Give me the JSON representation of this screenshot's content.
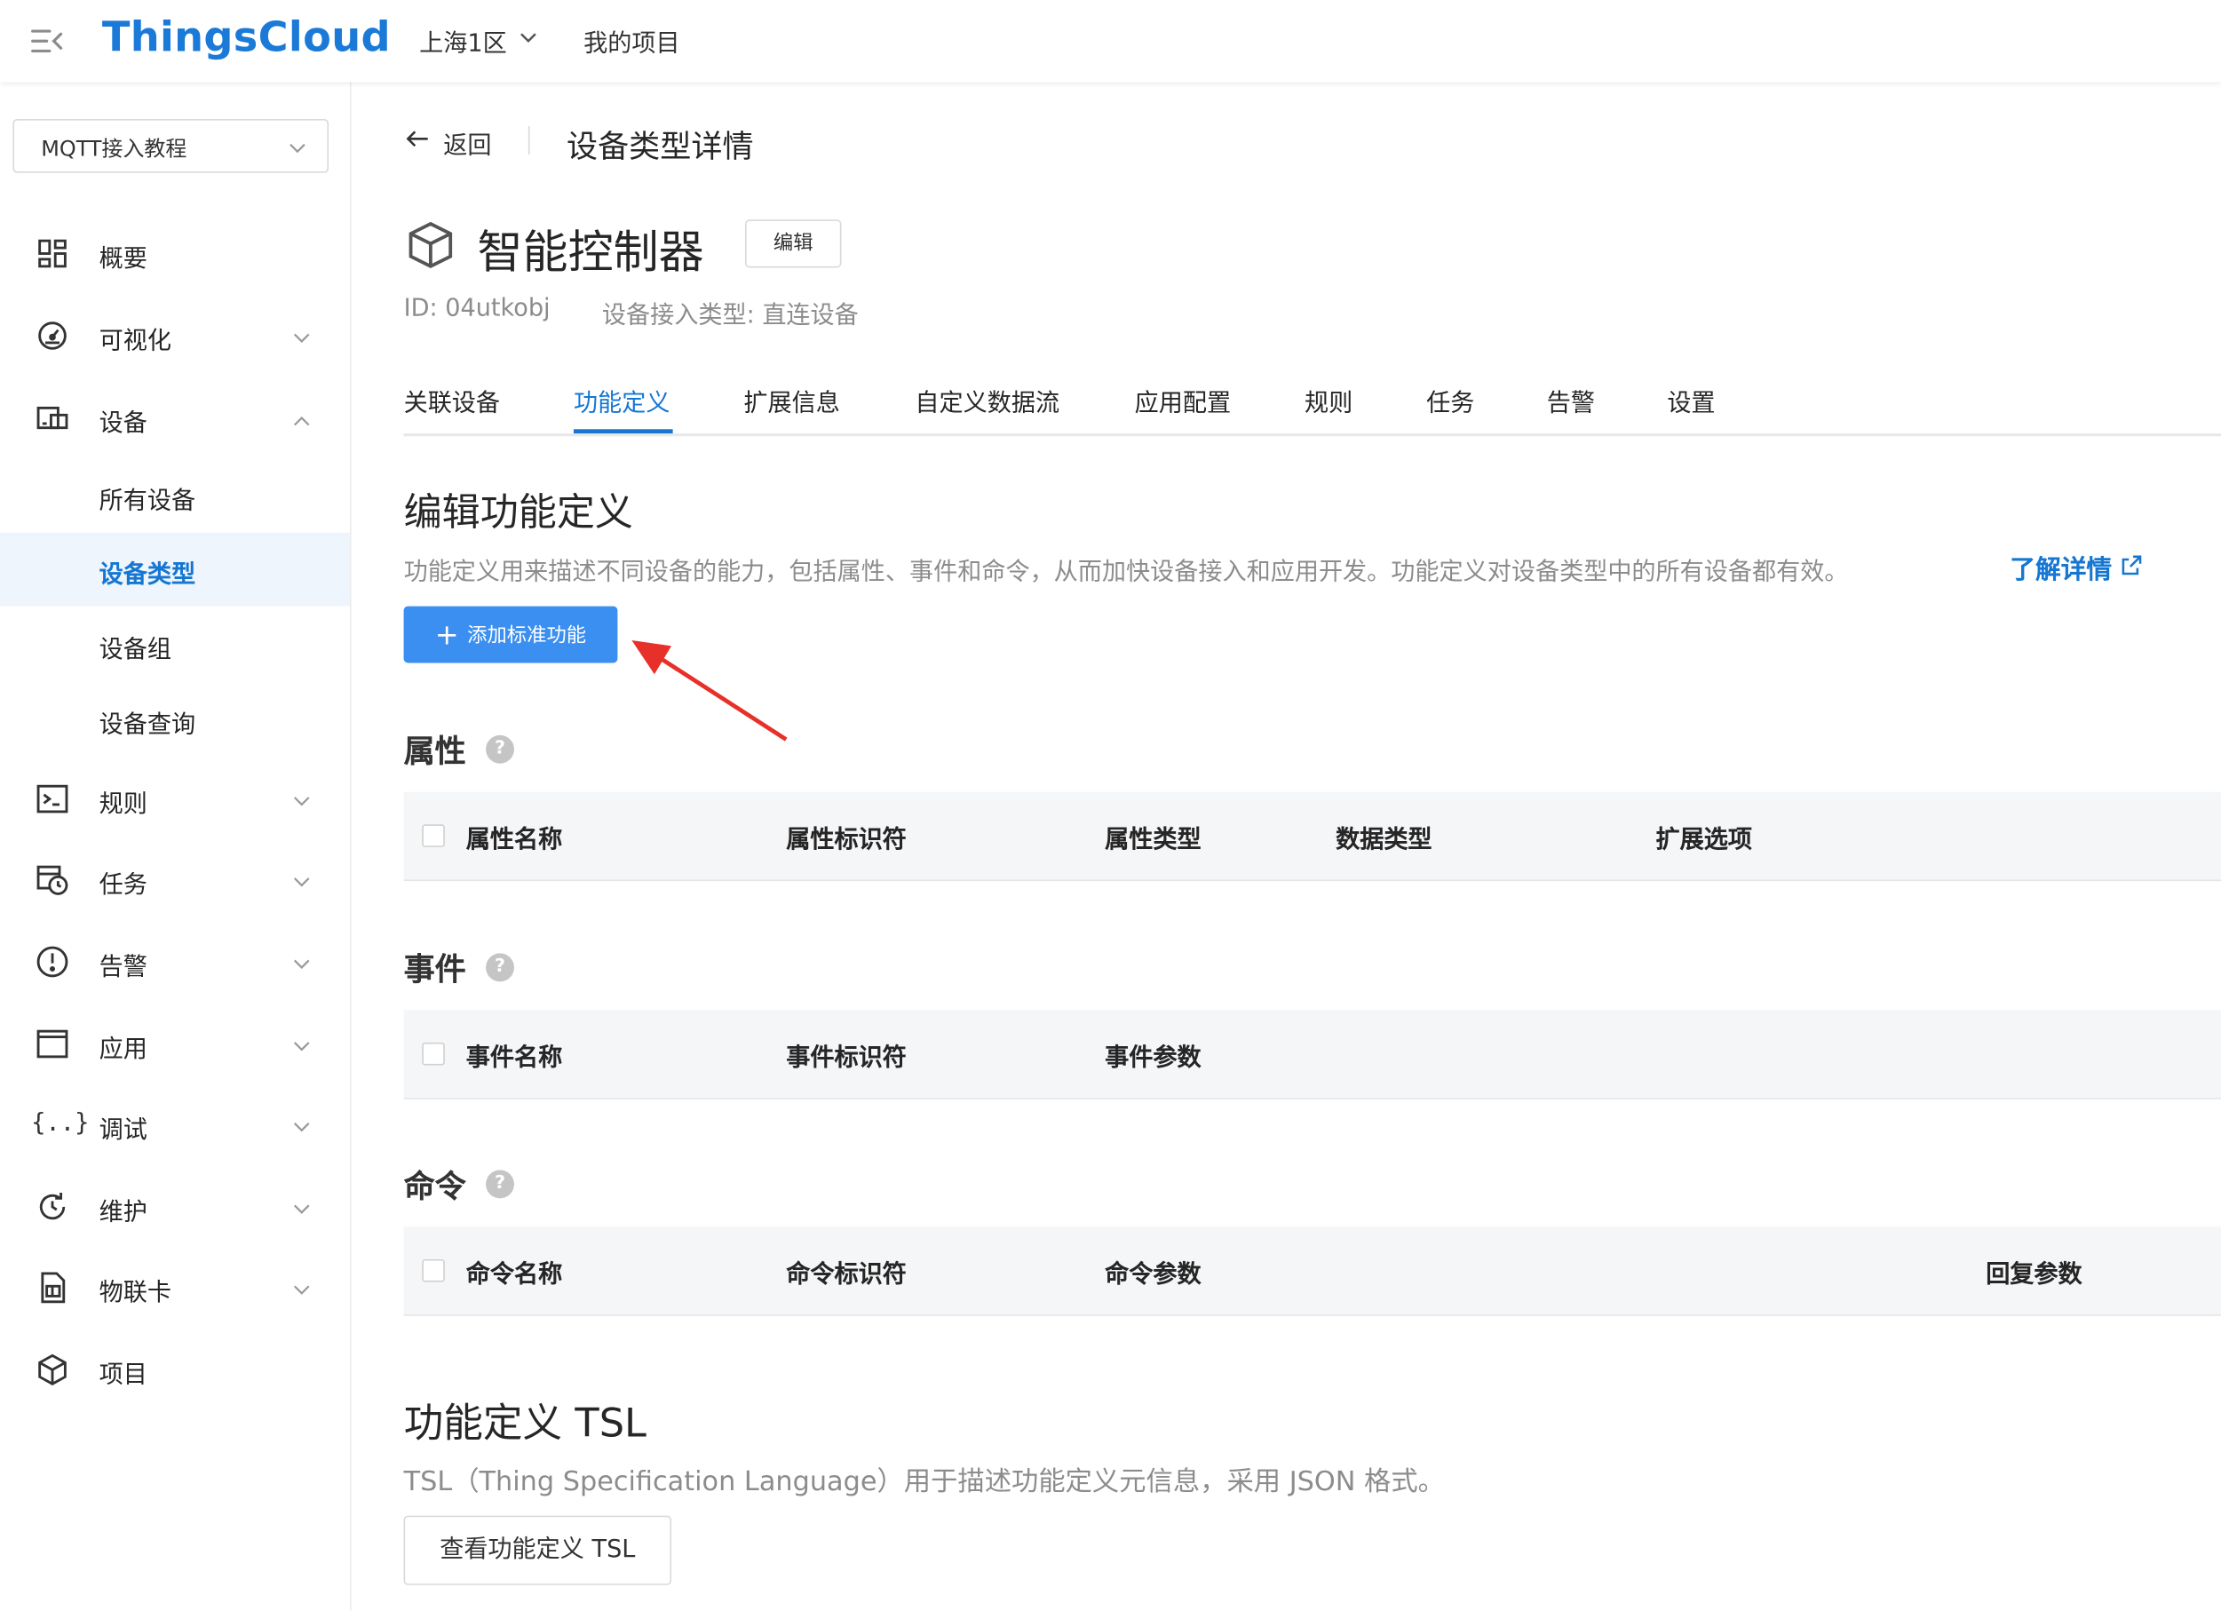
{
  "topbar": {
    "brand": "ThingsCloud",
    "region": "上海1区",
    "project_link": "我的项目"
  },
  "sidebar": {
    "project_select": "MQTT接入教程",
    "items": [
      {
        "label": "概要",
        "icon": "dashboard-icon"
      },
      {
        "label": "可视化",
        "icon": "gauge-icon"
      },
      {
        "label": "设备",
        "icon": "devices-icon"
      },
      {
        "label": "规则",
        "icon": "terminal-icon"
      },
      {
        "label": "任务",
        "icon": "scheduled-task-icon"
      },
      {
        "label": "告警",
        "icon": "alert-icon"
      },
      {
        "label": "应用",
        "icon": "window-icon"
      },
      {
        "label": "调试",
        "icon": "braces-icon"
      },
      {
        "label": "维护",
        "icon": "maintenance-icon"
      },
      {
        "label": "物联卡",
        "icon": "sim-card-icon"
      },
      {
        "label": "项目",
        "icon": "cube-icon"
      }
    ],
    "device_sub": [
      "所有设备",
      "设备类型",
      "设备组",
      "设备查询"
    ],
    "active_sub": "设备类型"
  },
  "header": {
    "back": "返回",
    "page_title": "设备类型详情",
    "device_name": "智能控制器",
    "edit": "编辑",
    "device_id": "ID: 04utkobj",
    "access_type": "设备接入类型: 直连设备"
  },
  "tabs": [
    "关联设备",
    "功能定义",
    "扩展信息",
    "自定义数据流",
    "应用配置",
    "规则",
    "任务",
    "告警",
    "设置"
  ],
  "active_tab": "功能定义",
  "section": {
    "title": "编辑功能定义",
    "desc": "功能定义用来描述不同设备的能力，包括属性、事件和命令，从而加快设备接入和应用开发。功能定义对设备类型中的所有设备都有效。",
    "learn_more": "了解详情",
    "add_button": "添加标准功能"
  },
  "groups": {
    "properties": {
      "title": "属性",
      "columns": [
        "属性名称",
        "属性标识符",
        "属性类型",
        "数据类型",
        "扩展选项"
      ]
    },
    "events": {
      "title": "事件",
      "columns": [
        "事件名称",
        "事件标识符",
        "事件参数"
      ]
    },
    "commands": {
      "title": "命令",
      "columns": [
        "命令名称",
        "命令标识符",
        "命令参数",
        "回复参数"
      ]
    }
  },
  "tsl": {
    "title": "功能定义 TSL",
    "desc": "TSL（Thing Specification Language）用于描述功能定义元信息，采用 JSON 格式。",
    "button": "查看功能定义 TSL"
  },
  "colors": {
    "accent": "#1677d2",
    "primary_button": "#3b8ff0",
    "annotation_arrow": "#e8302a"
  }
}
